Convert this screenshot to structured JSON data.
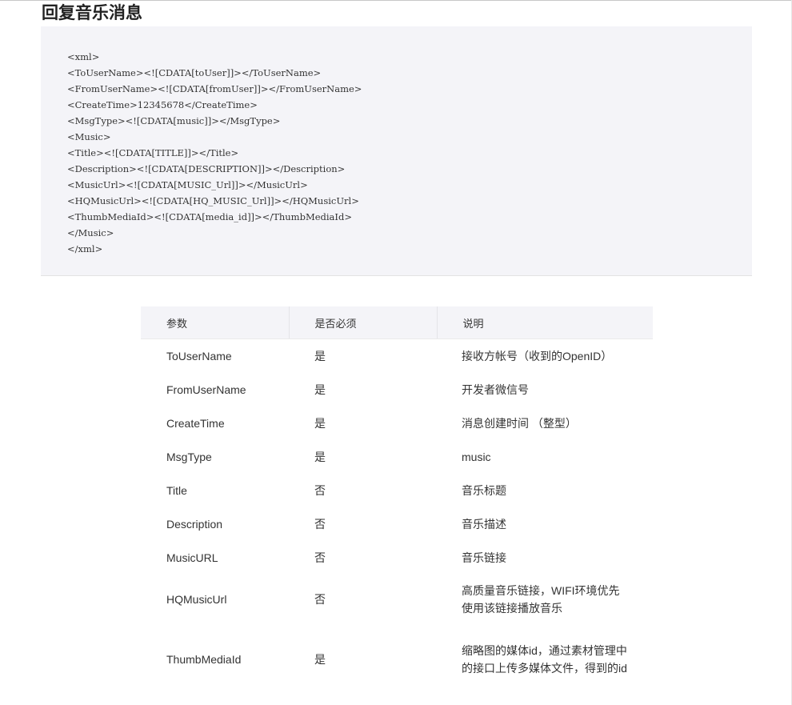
{
  "page": {
    "title": "回复音乐消息"
  },
  "code_block": {
    "lines": [
      "<xml>",
      "<ToUserName><![CDATA[toUser]]></ToUserName>",
      "<FromUserName><![CDATA[fromUser]]></FromUserName>",
      "<CreateTime>12345678</CreateTime>",
      "<MsgType><![CDATA[music]]></MsgType>",
      "<Music>",
      "<Title><![CDATA[TITLE]]></Title>",
      "<Description><![CDATA[DESCRIPTION]]></Description>",
      "<MusicUrl><![CDATA[MUSIC_Url]]></MusicUrl>",
      "<HQMusicUrl><![CDATA[HQ_MUSIC_Url]]></HQMusicUrl>",
      "<ThumbMediaId><![CDATA[media_id]]></ThumbMediaId>",
      "</Music>",
      "</xml>"
    ]
  },
  "table": {
    "headers": [
      "参数",
      "是否必须",
      "说明"
    ],
    "rows": [
      {
        "param": "ToUserName",
        "required": "是",
        "desc": "接收方帐号（收到的OpenID）"
      },
      {
        "param": "FromUserName",
        "required": "是",
        "desc": "开发者微信号"
      },
      {
        "param": "CreateTime",
        "required": "是",
        "desc": "消息创建时间 （整型）"
      },
      {
        "param": "MsgType",
        "required": "是",
        "desc": "music"
      },
      {
        "param": "Title",
        "required": "否",
        "desc": "音乐标题"
      },
      {
        "param": "Description",
        "required": "否",
        "desc": "音乐描述"
      },
      {
        "param": "MusicURL",
        "required": "否",
        "desc": "音乐链接"
      },
      {
        "param": "HQMusicUrl",
        "required": "否",
        "desc": "高质量音乐链接，WIFI环境优先使用该链接播放音乐"
      },
      {
        "param": "ThumbMediaId",
        "required": "是",
        "desc": "缩略图的媒体id，通过素材管理中的接口上传多媒体文件，得到的id"
      }
    ]
  }
}
